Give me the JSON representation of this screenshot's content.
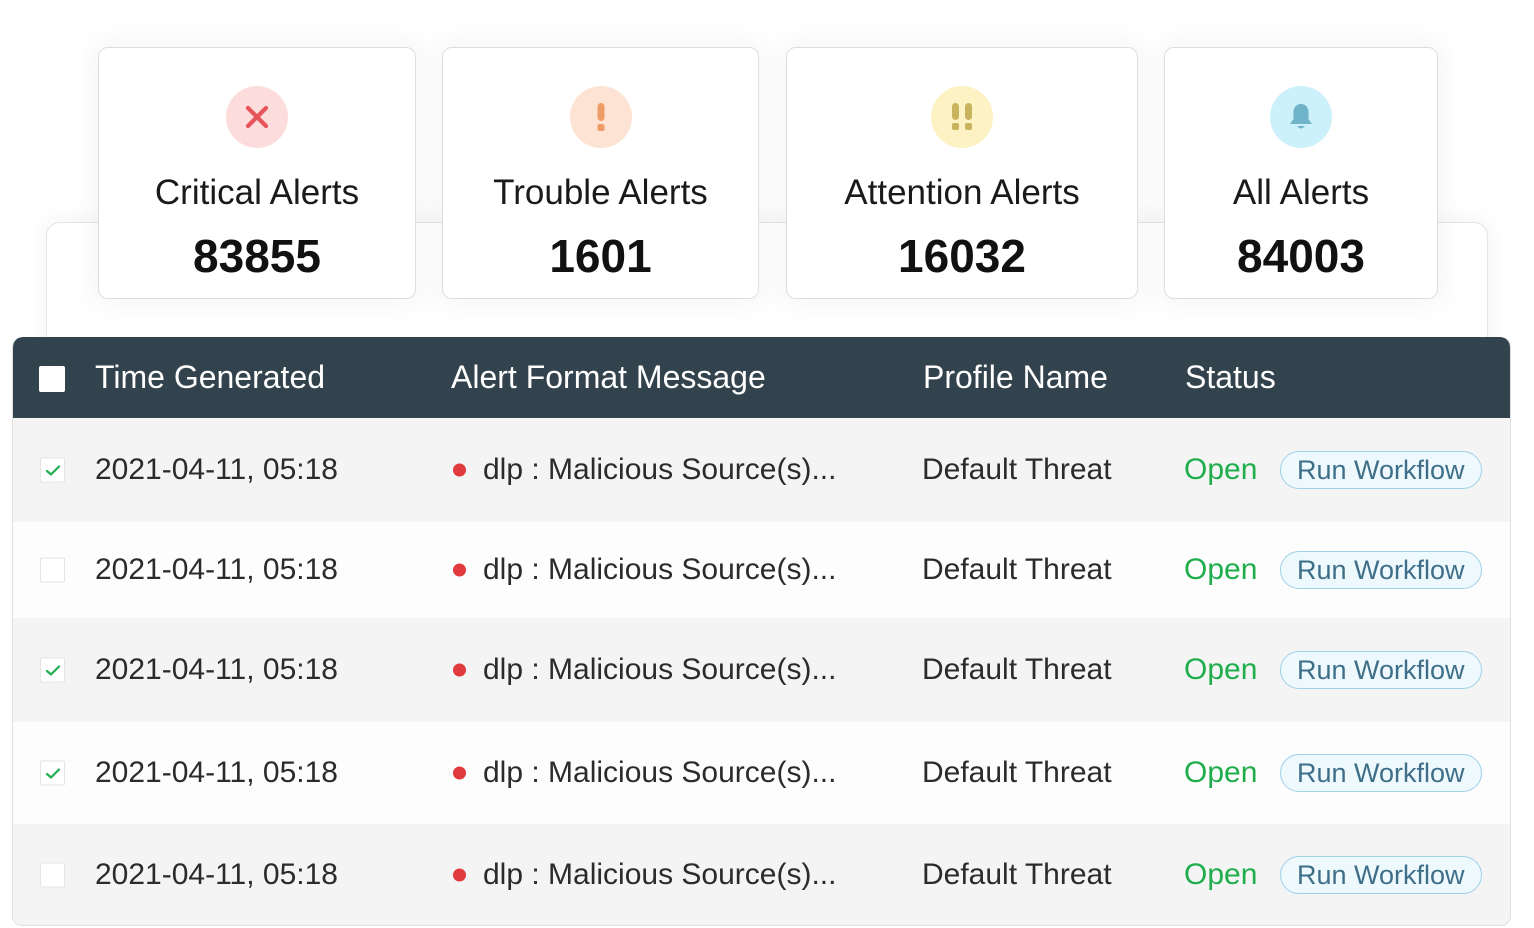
{
  "summary_cards": [
    {
      "id": "critical",
      "icon": "x-icon",
      "label": "Critical Alerts",
      "value": "83855",
      "icon_color": "#e5555a",
      "icon_bg": "#fddcdc"
    },
    {
      "id": "trouble",
      "icon": "exclamation-icon",
      "label": "Trouble Alerts",
      "value": "1601",
      "icon_color": "#ee9c68",
      "icon_bg": "#fde3d3"
    },
    {
      "id": "attention",
      "icon": "double-exclamation-icon",
      "label": "Attention Alerts",
      "value": "16032",
      "icon_color": "#c9b45e",
      "icon_bg": "#fdf2c3"
    },
    {
      "id": "all",
      "icon": "bell-icon",
      "label": "All Alerts",
      "value": "84003",
      "icon_color": "#6fb4c9",
      "icon_bg": "#cdf1fb"
    }
  ],
  "table": {
    "columns": [
      "Time Generated",
      "Alert Format Message",
      "Profile Name",
      "Status"
    ],
    "header_checked": false,
    "rows": [
      {
        "checked": true,
        "time": "2021-04-11, 05:18",
        "message": "dlp : Malicious Source(s)...",
        "profile": "Default Threat",
        "status": "Open",
        "action": "Run Workflow"
      },
      {
        "checked": false,
        "time": "2021-04-11, 05:18",
        "message": "dlp : Malicious Source(s)...",
        "profile": "Default Threat",
        "status": "Open",
        "action": "Run Workflow"
      },
      {
        "checked": true,
        "time": "2021-04-11, 05:18",
        "message": "dlp : Malicious Source(s)...",
        "profile": "Default Threat",
        "status": "Open",
        "action": "Run Workflow"
      },
      {
        "checked": true,
        "time": "2021-04-11, 05:18",
        "message": "dlp : Malicious Source(s)...",
        "profile": "Default Threat",
        "status": "Open",
        "action": "Run Workflow"
      },
      {
        "checked": false,
        "time": "2021-04-11, 05:18",
        "message": "dlp : Malicious Source(s)...",
        "profile": "Default Threat",
        "status": "Open",
        "action": "Run Workflow"
      }
    ]
  },
  "colors": {
    "header_bg": "#33434d",
    "status_open": "#1fae4b",
    "severity_dot": "#e03a3e",
    "check": "#1fae4b"
  }
}
